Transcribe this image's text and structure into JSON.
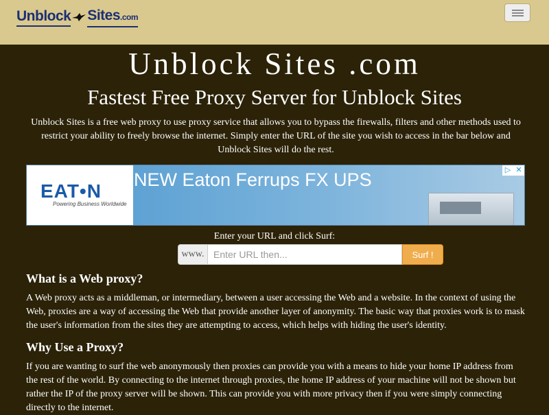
{
  "navbar": {
    "logo": {
      "part1": "Unblock",
      "part2": "Sites",
      "ext": ".com"
    },
    "menu_toggle_icon": "hamburger-icon",
    "colors": {
      "background": "#d9c98e",
      "logo": "#1d2f73"
    }
  },
  "header": {
    "title": "Unblock Sites .com",
    "subtitle": "Fastest Free Proxy Server for Unblock Sites",
    "intro": "Unblock Sites is a free web proxy to use proxy service that allows you to bypass the firewalls, filters and other methods used to restrict your ability to freely browse the internet. Simply enter the URL of the site you wish to access in the bar below and Unblock Sites will do the rest."
  },
  "ad": {
    "brand": "EAT•N",
    "tagline": "Powering Business Worldwide",
    "headline": "NEW Eaton Ferrups FX UPS",
    "choices_icon": "▷",
    "close_icon": "✕"
  },
  "form": {
    "label": "Enter your URL and click Surf:",
    "prefix": "www.",
    "placeholder": "Enter URL then...",
    "value": "",
    "submit_label": "Surf !",
    "colors": {
      "button": "#f0ad4e"
    }
  },
  "sections": [
    {
      "heading": "What is a Web proxy?",
      "text": "A Web proxy acts as a middleman, or intermediary, between a user accessing the Web and a website. In the context of using the Web, proxies are a way of accessing the Web that provide another layer of anonymity. The basic way that proxies work is to mask the user's information from the sites they are attempting to access, which helps with hiding the user's identity."
    },
    {
      "heading": "Why Use a Proxy?",
      "text": "If you are wanting to surf the web anonymously then proxies can provide you with a means to hide your home IP address from the rest of the world. By connecting to the internet through proxies, the home IP address of your machine will not be shown but rather the IP of the proxy server will be shown. This can provide you with more privacy then if you were simply connecting directly to the internet."
    }
  ],
  "colors": {
    "page_background": "#2b2208",
    "text": "#ffffff"
  }
}
